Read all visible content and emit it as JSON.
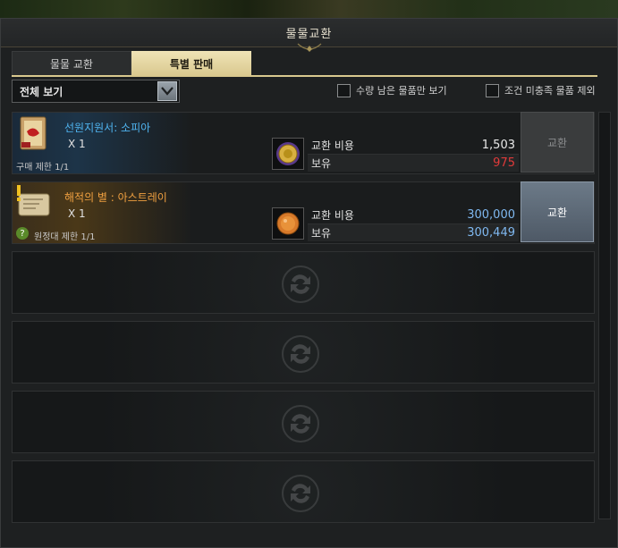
{
  "window": {
    "title": "물물교환"
  },
  "tabs": [
    {
      "label": "물물 교환",
      "active": false
    },
    {
      "label": "특별 판매",
      "active": true
    }
  ],
  "filter": {
    "dropdown_value": "전체 보기",
    "checkbox_stock_only": "수량 남은 물품만 보기",
    "checkbox_exclude_unmet": "조건 미충족 물품 제외"
  },
  "items": [
    {
      "name": "선원지원서: 소피아",
      "quantity": "X 1",
      "limit": "구매 제한 1/1",
      "cost_label": "교환 비용",
      "cost_value": "1,503",
      "owned_label": "보유",
      "owned_value": "975",
      "button": "교환",
      "icon": "scroll-icon",
      "cost_icon": "gold-coin-icon"
    },
    {
      "name": "해적의 별 : 아스트레이",
      "quantity": "X 1",
      "limit_q": "?",
      "limit": "원정대 제한 1/1",
      "cost_label": "교환 비용",
      "cost_value": "300,000",
      "owned_label": "보유",
      "owned_value": "300,449",
      "button": "교환",
      "icon": "map-icon",
      "cost_icon": "copper-coin-icon"
    }
  ],
  "colors": {
    "accent_gold": "#d9c88e",
    "name_blue": "#4fb4f0",
    "name_orange": "#f0a040",
    "insufficient_red": "#e03a3a"
  }
}
